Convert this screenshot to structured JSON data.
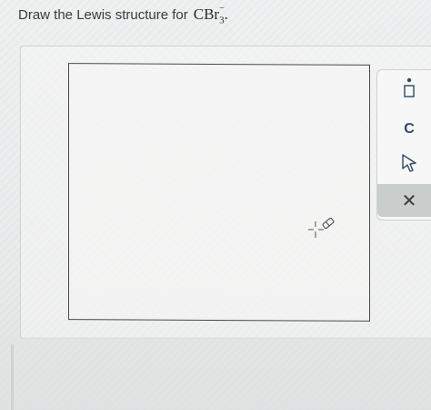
{
  "question": {
    "prefix": "Draw the Lewis structure for",
    "formula_main": "CBr",
    "formula_subscript": "3",
    "formula_charge": "−",
    "formula_period": "."
  },
  "toolbar": {
    "carbon_label": "C",
    "close_label": "✕"
  },
  "colors": {
    "tool_blue": "#2c4a68",
    "close_bg": "#c9cdcc"
  }
}
